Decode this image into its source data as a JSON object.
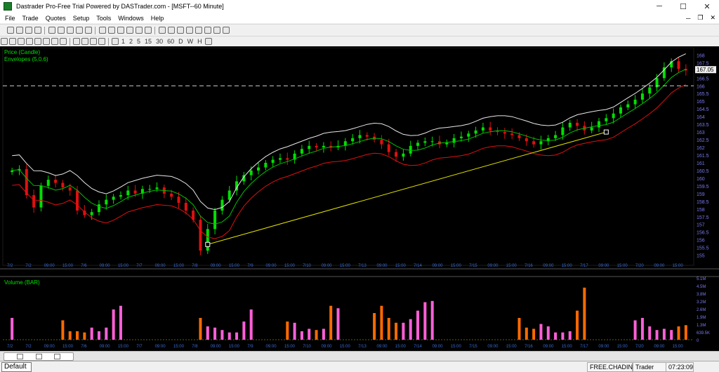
{
  "window": {
    "title": "Dastrader Pro-Free Trial Powered by DASTrader.com - [MSFT--60 Minute]",
    "minimize": "─",
    "maximize": "☐",
    "close": "✕",
    "inner_minimize": "─",
    "inner_restore": "❐",
    "inner_close": "✕"
  },
  "menu": [
    "File",
    "Trade",
    "Quotes",
    "Setup",
    "Tools",
    "Windows",
    "Help"
  ],
  "toolbar2_text": [
    "1",
    "2",
    "5",
    "15",
    "30",
    "60",
    "D",
    "W",
    "H"
  ],
  "chart": {
    "price_label": "Price (Candle)",
    "envelope_label": "Envelopes (5,0.6)",
    "volume_label": "Volume (BAR)",
    "last_price": "167.05",
    "price_ticks": [
      "168",
      "167.5",
      "167",
      "166.5",
      "166",
      "165.5",
      "165",
      "164.5",
      "164",
      "163.5",
      "163",
      "162.5",
      "162",
      "161.5",
      "161",
      "160.5",
      "160",
      "159.5",
      "159",
      "158.5",
      "158",
      "157.5",
      "157",
      "156.5",
      "156",
      "155.5",
      "155"
    ],
    "volume_ticks": [
      "5.1M",
      "4.5M",
      "3.8M",
      "3.2M",
      "2.6M",
      "1.9M",
      "1.3M",
      "639.5K",
      "0"
    ],
    "time_labels": [
      "7/2",
      "7/2",
      "09:00",
      "15:00",
      "7/6",
      "09:00",
      "15:00",
      "7/7",
      "09:00",
      "15:00",
      "7/8",
      "09:00",
      "15:00",
      "7/9",
      "09:00",
      "15:00",
      "7/10",
      "09:00",
      "15:00",
      "7/13",
      "09:00",
      "15:00",
      "7/14",
      "09:00",
      "15:00",
      "7/15",
      "09:00",
      "15:00",
      "7/16",
      "09:00",
      "15:00",
      "7/17",
      "09:00",
      "15:00",
      "7/20",
      "09:00",
      "15:00"
    ],
    "colors": {
      "up": "#00e000",
      "down": "#e01010",
      "upper_env": "#e8e8e8",
      "lower_env": "#e01010",
      "mid_env": "#00c000",
      "trendline": "#e0e000",
      "vol_up": "#ff5fd7",
      "vol_down": "#ff6a00"
    }
  },
  "chart_data": {
    "type": "candlestick",
    "symbol": "MSFT",
    "interval": "60 Minute",
    "ylim": [
      154.8,
      168.2
    ],
    "close": [
      160.5,
      160.6,
      158.9,
      158.1,
      159.5,
      159.9,
      159.7,
      159.4,
      159.2,
      157.9,
      157.6,
      157.8,
      158.3,
      158.6,
      158.8,
      158.9,
      159.2,
      159.0,
      159.3,
      159.3,
      159.4,
      159.0,
      158.8,
      158.4,
      157.9,
      157.3,
      155.3,
      156.7,
      157.9,
      158.6,
      159.2,
      159.8,
      160.2,
      160.5,
      160.7,
      161.0,
      161.2,
      161.3,
      161.2,
      161.6,
      161.9,
      162.1,
      162.0,
      162.1,
      162.0,
      162.1,
      162.4,
      162.6,
      162.8,
      162.7,
      162.5,
      162.2,
      161.7,
      161.4,
      161.6,
      162.1,
      162.3,
      162.4,
      162.4,
      162.2,
      162.3,
      162.6,
      162.7,
      162.9,
      163.1,
      163.3,
      163.1,
      163.0,
      162.9,
      162.8,
      162.6,
      162.4,
      162.2,
      162.4,
      162.6,
      162.8,
      163.3,
      163.6,
      163.4,
      163.1,
      163.3,
      163.7,
      163.9,
      164.2,
      164.6,
      164.8,
      165.1,
      165.5,
      165.9,
      166.5,
      167.2,
      167.6,
      167.1,
      167.0
    ],
    "volume_millions": [
      1.8,
      0.0,
      0.0,
      0.0,
      0.0,
      0.0,
      0.0,
      1.6,
      0.7,
      0.7,
      0.6,
      1.0,
      0.7,
      1.0,
      2.5,
      2.8,
      0.0,
      0.0,
      0.0,
      0.0,
      0.0,
      0.0,
      0.0,
      0.0,
      0.0,
      0.0,
      1.8,
      1.1,
      1.0,
      0.8,
      0.6,
      0.6,
      1.5,
      2.5,
      0.0,
      0.0,
      0.0,
      0.0,
      1.5,
      1.4,
      0.7,
      0.9,
      0.8,
      0.9,
      2.8,
      2.6,
      0.0,
      0.0,
      0.0,
      0.0,
      2.2,
      2.8,
      1.8,
      1.4,
      1.4,
      1.7,
      2.4,
      3.1,
      3.2,
      0.0,
      0.0,
      0.0,
      0.0,
      0.0,
      0.0,
      0.0,
      0.0,
      0.0,
      0.0,
      0.0,
      1.8,
      1.0,
      0.9,
      1.3,
      1.1,
      0.6,
      0.6,
      0.7,
      2.4,
      4.3,
      0.0,
      0.0,
      0.0,
      0.0,
      0.0,
      0.0,
      1.6,
      1.8,
      1.1,
      0.8,
      0.9,
      0.8,
      1.1,
      1.2
    ]
  },
  "statusbar": {
    "tab": "Default",
    "account": "FREE.CHADINC",
    "role": "Trader",
    "time": "07:23:09"
  }
}
